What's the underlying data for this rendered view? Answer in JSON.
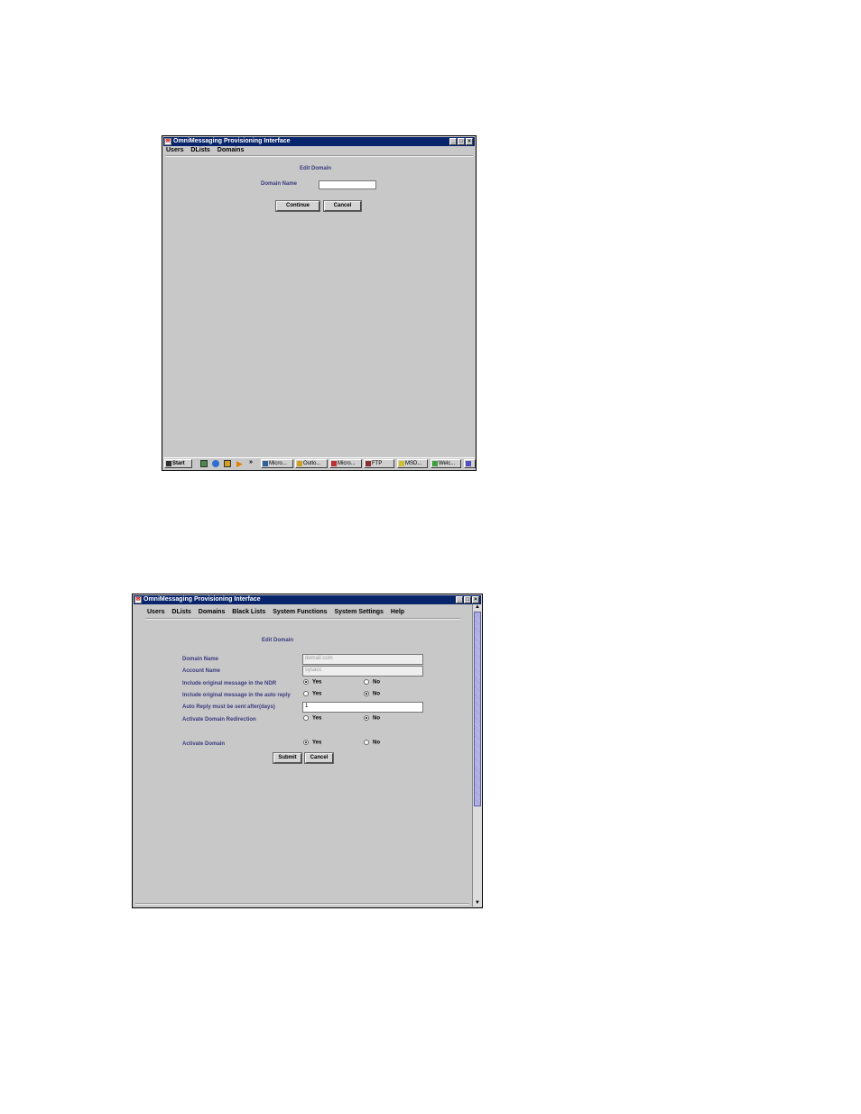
{
  "window1": {
    "title": "OmniMessaging Provisioning Interface",
    "menu": [
      "Users",
      "DLists",
      "Domains"
    ],
    "heading": "Edit Domain",
    "domain_label": "Domain Name",
    "domain_value": "",
    "continue_label": "Continue",
    "cancel_label": "Cancel",
    "taskbar": {
      "start": "Start",
      "chevron": "»",
      "items": [
        "Micro...",
        "Outlo...",
        "Micro...",
        "FTP",
        "MSD...",
        "Welc..."
      ]
    }
  },
  "window2": {
    "title": "OmniMessaging Provisioning Interface",
    "menu": [
      "Users",
      "DLists",
      "Domains",
      "Black Lists",
      "System Functions",
      "System Settings",
      "Help"
    ],
    "heading": "Edit Domain",
    "domain_name_label": "Domain Name",
    "domain_name_value": "demail.com",
    "account_name_label": "Account Name",
    "account_name_value": "sysacc",
    "ndr_label": "Include original message in the NDR",
    "ndr_yes": "Yes",
    "ndr_no": "No",
    "auto_reply_label": "Include original message in the auto reply",
    "auto_reply_yes": "Yes",
    "auto_reply_no": "No",
    "days_label": "Auto Reply must be sent after(days)",
    "days_value": "1",
    "redirection_label": "Activate Domain Redirection",
    "redirection_yes": "Yes",
    "redirection_no": "No",
    "activate_label": "Activate Domain",
    "activate_yes": "Yes",
    "activate_no": "No",
    "submit_label": "Submit",
    "cancel_label": "Cancel"
  }
}
